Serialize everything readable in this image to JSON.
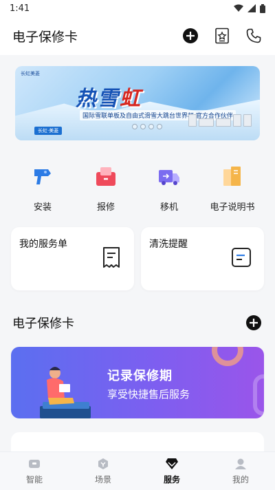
{
  "status": {
    "time": "1:41"
  },
  "header": {
    "title": "电子保修卡"
  },
  "banner": {
    "heading_part1": "热雪",
    "heading_part2": "虹",
    "subline": "国际雪联单板及自由式滑雪大跳台世界杯 官方合作伙伴",
    "tag": "长虹·美菱",
    "logo": "长虹美菱"
  },
  "quick_actions": [
    {
      "label": "安装",
      "icon": "install-icon"
    },
    {
      "label": "报修",
      "icon": "repair-icon"
    },
    {
      "label": "移机",
      "icon": "move-truck-icon"
    },
    {
      "label": "电子说明书",
      "icon": "manual-icon"
    }
  ],
  "cards": [
    {
      "title": "我的服务单",
      "icon": "receipt-icon"
    },
    {
      "title": "清洗提醒",
      "icon": "note-icon"
    }
  ],
  "section": {
    "title": "电子保修卡"
  },
  "promo": {
    "title": "记录保修期",
    "subtitle": "享受快捷售后服务"
  },
  "tabs": [
    {
      "label": "智能",
      "icon": "smart-icon",
      "active": false
    },
    {
      "label": "场景",
      "icon": "scene-icon",
      "active": false
    },
    {
      "label": "服务",
      "icon": "service-diamond-icon",
      "active": true
    },
    {
      "label": "我的",
      "icon": "profile-icon",
      "active": false
    }
  ],
  "colors": {
    "accent": "#111111",
    "promo_start": "#5b6ff0",
    "promo_end": "#9a55ea",
    "icon_blue": "#2c7be5",
    "icon_red": "#ef4a5b",
    "icon_purple": "#7b6cf0",
    "icon_orange": "#f5b54a"
  }
}
